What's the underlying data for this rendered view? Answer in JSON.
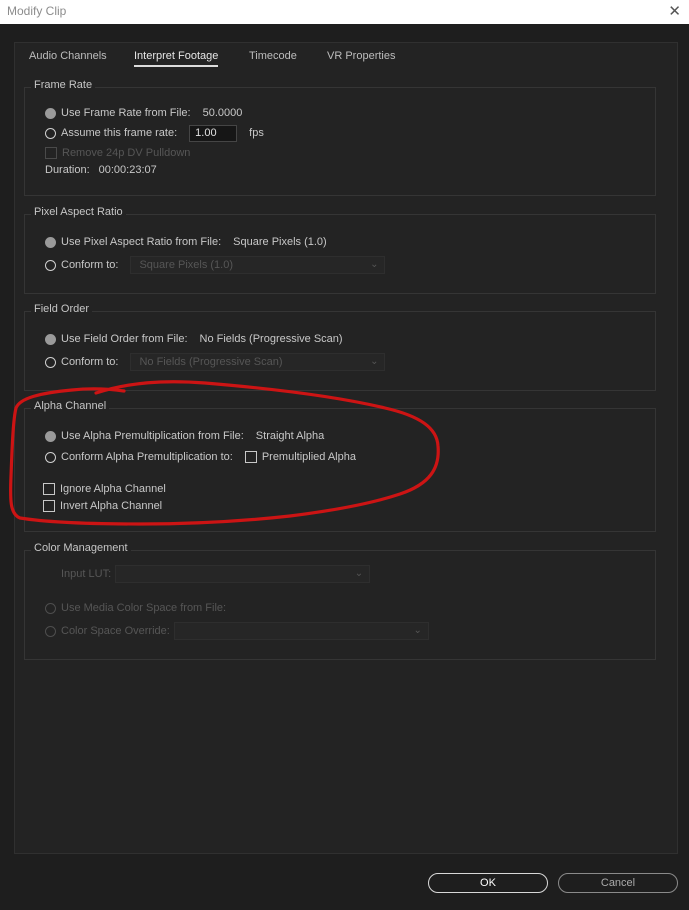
{
  "window": {
    "title": "Modify Clip",
    "close_glyph": "✕"
  },
  "tabs": [
    {
      "label": "Audio Channels",
      "active": false
    },
    {
      "label": "Interpret Footage",
      "active": true
    },
    {
      "label": "Timecode",
      "active": false
    },
    {
      "label": "VR Properties",
      "active": false
    }
  ],
  "frame_rate": {
    "title": "Frame Rate",
    "use_from_file": {
      "label": "Use Frame Rate from File:",
      "value": "50.0000",
      "selected": true
    },
    "assume": {
      "label": "Assume this frame rate:",
      "value": "1.00",
      "unit": "fps",
      "selected": false
    },
    "remove_pulldown": {
      "label": "Remove 24p DV Pulldown",
      "checked": false,
      "enabled": false
    },
    "duration": {
      "label": "Duration:",
      "value": "00:00:23:07"
    }
  },
  "pixel_aspect": {
    "title": "Pixel Aspect Ratio",
    "use_from_file": {
      "label": "Use Pixel Aspect Ratio from File:",
      "value": "Square Pixels (1.0)",
      "selected": true
    },
    "conform": {
      "label": "Conform to:",
      "value": "Square Pixels (1.0)",
      "selected": false
    }
  },
  "field_order": {
    "title": "Field Order",
    "use_from_file": {
      "label": "Use Field Order from File:",
      "value": "No Fields (Progressive Scan)",
      "selected": true
    },
    "conform": {
      "label": "Conform to:",
      "value": "No Fields (Progressive Scan)",
      "selected": false
    }
  },
  "alpha_channel": {
    "title": "Alpha Channel",
    "use_from_file": {
      "label": "Use Alpha Premultiplication from File:",
      "value": "Straight Alpha",
      "selected": true
    },
    "conform": {
      "label": "Conform Alpha Premultiplication to:",
      "selected": false
    },
    "premultiplied": {
      "label": "Premultiplied Alpha",
      "checked": false
    },
    "ignore": {
      "label": "Ignore Alpha Channel",
      "checked": false
    },
    "invert": {
      "label": "Invert Alpha Channel",
      "checked": false
    }
  },
  "color_management": {
    "title": "Color Management",
    "input_lut": {
      "label": "Input LUT:",
      "value": ""
    },
    "use_media": {
      "label": "Use Media Color Space from File:",
      "selected": false
    },
    "override": {
      "label": "Color Space Override:",
      "value": ""
    }
  },
  "buttons": {
    "ok": "OK",
    "cancel": "Cancel"
  },
  "annotation": {
    "color": "#cc1414"
  },
  "icons": {
    "dropdown": "⌄"
  },
  "colors": {
    "background": "#1e1e1e",
    "panel": "#232323",
    "titlebar": "#ffffff"
  }
}
